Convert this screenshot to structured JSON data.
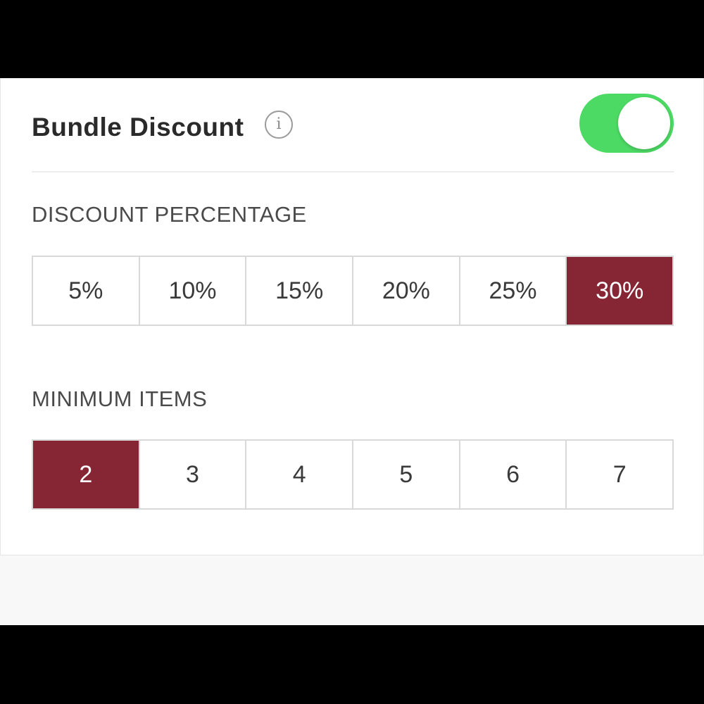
{
  "header": {
    "title": "Bundle Discount",
    "info_icon": "info-icon",
    "info_glyph": "i",
    "toggle": {
      "on": true,
      "color": "#4cd964"
    }
  },
  "discount_percentage": {
    "label": "DISCOUNT PERCENTAGE",
    "options": [
      "5%",
      "10%",
      "15%",
      "20%",
      "25%",
      "30%"
    ],
    "selected": "30%"
  },
  "minimum_items": {
    "label": "MINIMUM ITEMS",
    "options": [
      "2",
      "3",
      "4",
      "5",
      "6",
      "7"
    ],
    "selected": "2"
  },
  "colors": {
    "accent": "#862634",
    "toggle_on": "#4cd964"
  }
}
